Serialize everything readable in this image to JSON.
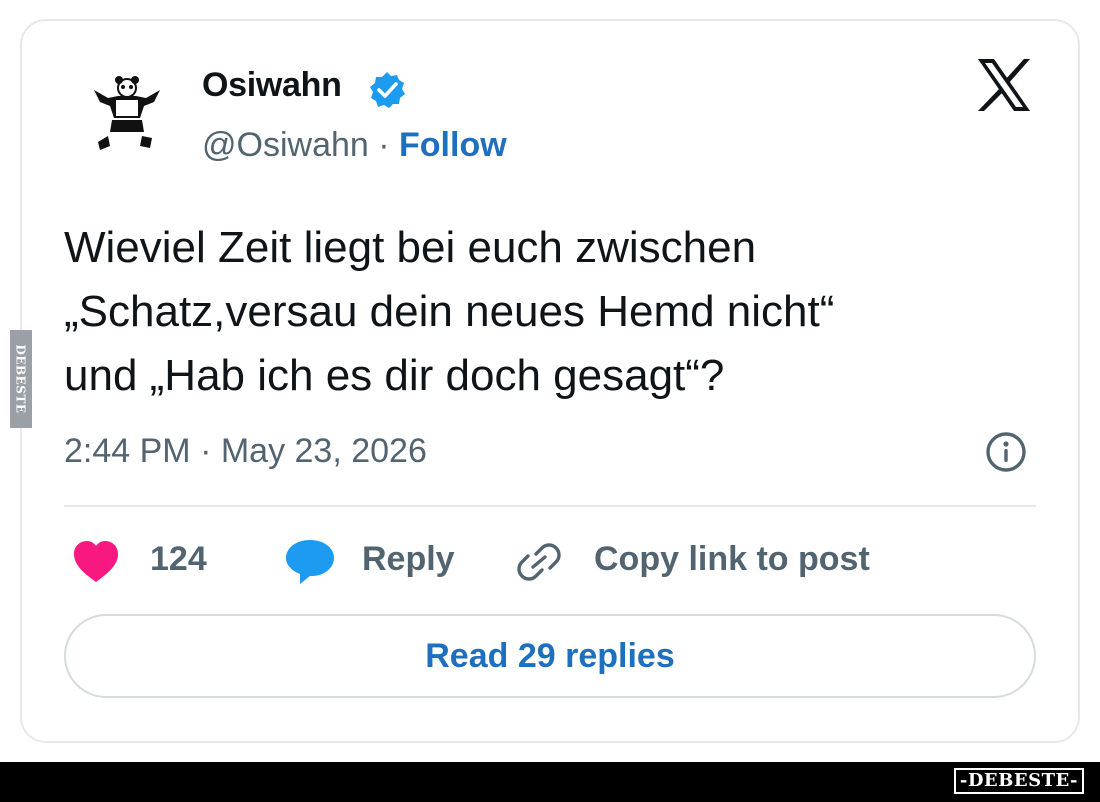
{
  "tweet": {
    "author_name": "Osiwahn",
    "handle": "@Osiwahn",
    "separator": " · ",
    "follow_label": "Follow",
    "text": "Wieviel Zeit liegt bei euch zwischen\n„Schatz,versau dein neues Hemd nicht“\nund „Hab ich es dir doch gesagt“?",
    "timestamp": "2:44 PM · May 23, 2026"
  },
  "actions": {
    "like_count": "124",
    "reply_label": "Reply",
    "copy_link_label": "Copy link to post",
    "read_replies_label": "Read 29 replies"
  },
  "watermark": {
    "side_text": "DEBESTE",
    "bottom_text": "-DEBESTE-"
  },
  "colors": {
    "link_blue": "#1d6fbf",
    "verified_blue": "#1d9bf0",
    "heart_pink": "#f91880",
    "secondary_text": "#536471"
  },
  "icons": [
    "panda-avatar-icon",
    "verified-badge-icon",
    "x-logo-icon",
    "info-icon",
    "heart-icon",
    "reply-bubble-icon",
    "link-icon"
  ]
}
